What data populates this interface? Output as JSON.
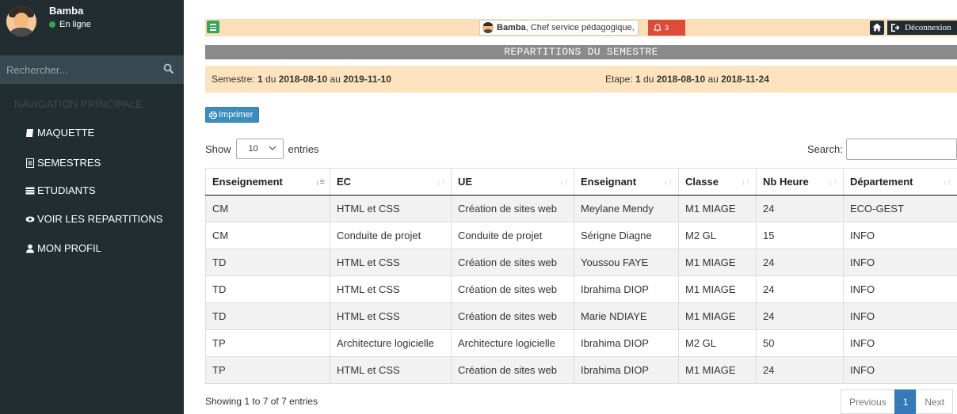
{
  "sidebar": {
    "user_name": "Bamba",
    "user_status": "En ligne",
    "search_placeholder": "Rechercher...",
    "nav_header": "NAVIGATION PRINCIPALE",
    "items": [
      {
        "label": "MAQUETTE",
        "icon": "book-icon"
      },
      {
        "label": "SEMESTRES",
        "icon": "file-icon"
      },
      {
        "label": "ETUDIANTS",
        "icon": "list-icon"
      },
      {
        "label": "VOIR LES REPARTITIONS",
        "icon": "eye-icon"
      },
      {
        "label": "MON PROFIL",
        "icon": "user-icon"
      }
    ]
  },
  "topbar": {
    "user_name": "Bamba",
    "user_role": ", Chef service pédagogique,",
    "notif_count": "3",
    "logout_label": "Déconnexion"
  },
  "page": {
    "title": "REPARTITIONS DU SEMESTRE",
    "semestre_label": "Semestre: ",
    "semestre_num": "1",
    "semestre_du": " du ",
    "semestre_start": "2018-08-10",
    "semestre_au": " au ",
    "semestre_end": "2019-11-10",
    "etape_label": "Etape: ",
    "etape_num": "1",
    "etape_du": " du ",
    "etape_start": "2018-08-10",
    "etape_au": " au ",
    "etape_end": "2018-11-24",
    "print_label": "Imprimer"
  },
  "table_controls": {
    "show_label": "Show",
    "entries_value": "10",
    "entries_label": "entries",
    "search_label": "Search:"
  },
  "table": {
    "headers": [
      "Enseignement",
      "EC",
      "UE",
      "Enseignant",
      "Classe",
      "Nb Heure",
      "Département"
    ],
    "rows": [
      [
        "CM",
        "HTML et CSS",
        "Création de sites web",
        "Meylane Mendy",
        "M1 MIAGE",
        "24",
        "ECO-GEST"
      ],
      [
        "CM",
        "Conduite de projet",
        "Conduite de projet",
        "Sérigne Diagne",
        "M2 GL",
        "15",
        "INFO"
      ],
      [
        "TD",
        "HTML et CSS",
        "Création de sites web",
        "Youssou FAYE",
        "M1 MIAGE",
        "24",
        "INFO"
      ],
      [
        "TD",
        "HTML et CSS",
        "Création de sites web",
        "Ibrahima DIOP",
        "M1 MIAGE",
        "24",
        "INFO"
      ],
      [
        "TD",
        "HTML et CSS",
        "Création de sites web",
        "Marie NDIAYE",
        "M1 MIAGE",
        "24",
        "INFO"
      ],
      [
        "TP",
        "Architecture logicielle",
        "Architecture logicielle",
        "Ibrahima DIOP",
        "M2 GL",
        "50",
        "INFO"
      ],
      [
        "TP",
        "HTML et CSS",
        "Création de sites web",
        "Ibrahima DIOP",
        "M1 MIAGE",
        "24",
        "INFO"
      ]
    ]
  },
  "footer": {
    "info": "Showing 1 to 7 of 7 entries",
    "prev": "Previous",
    "page": "1",
    "next": "Next"
  },
  "colors": {
    "sidebar_bg": "#222d32",
    "topbar_bg": "#fcdfb8",
    "title_bar_bg": "#8a8a8a",
    "primary": "#3c8dbc",
    "danger": "#dd4b39",
    "success": "#3aa35a"
  }
}
